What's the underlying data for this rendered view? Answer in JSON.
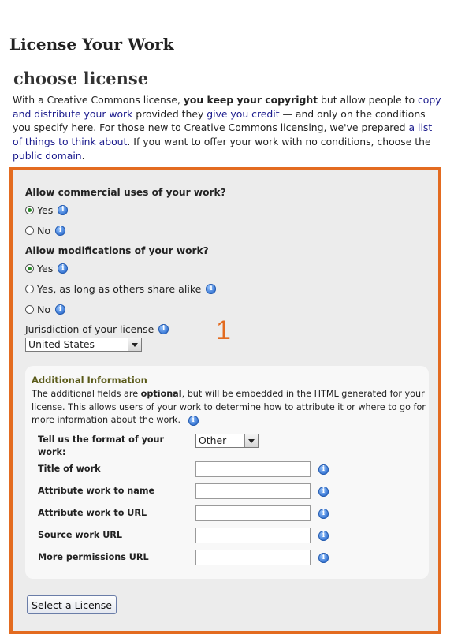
{
  "page_title": "License Your Work",
  "section_title": "choose license",
  "intro": {
    "t1": "With a Creative Commons license, ",
    "t1_bold": "you keep your copyright",
    "t2": " but allow people to ",
    "link1": "copy and distribute your work",
    "t3": " provided they ",
    "link2": "give you credit",
    "t4": " — and only on the conditions you specify here. For those new to Creative Commons licensing, we've prepared ",
    "link3": "a list of things to think about",
    "t5": ". If you want to offer your work with no conditions, choose the ",
    "link4": "public domain",
    "t6": "."
  },
  "commercial": {
    "question": "Allow commercial uses of your work?",
    "options": [
      "Yes",
      "No"
    ],
    "selected": "Yes"
  },
  "modifications": {
    "question": "Allow modifications of your work?",
    "options": [
      "Yes",
      "Yes, as long as others share alike",
      "No"
    ],
    "selected": "Yes"
  },
  "jurisdiction": {
    "label": "Jurisdiction of your license",
    "value": "United States"
  },
  "step_number": "1",
  "additional": {
    "title": "Additional Information",
    "desc_1": "The additional fields are ",
    "desc_bold": "optional",
    "desc_2": ", but will be embedded in the HTML generated for your license. This allows users of your work to determine how to attribute it or where to go for more information about the work.",
    "format_label": "Tell us the format of your work:",
    "format_value": "Other",
    "fields": [
      {
        "label": "Title of work",
        "value": ""
      },
      {
        "label": "Attribute work to name",
        "value": ""
      },
      {
        "label": "Attribute work to URL",
        "value": ""
      },
      {
        "label": "Source work URL",
        "value": ""
      },
      {
        "label": "More permissions URL",
        "value": ""
      }
    ]
  },
  "submit_label": "Select a License",
  "icons": {
    "info": "info-icon",
    "info_glyph": "i"
  },
  "colors": {
    "panel_border": "#e36b20",
    "panel_bg": "#ececec",
    "link": "#1a1a8c",
    "radio_selected": "#2a8a2a"
  }
}
